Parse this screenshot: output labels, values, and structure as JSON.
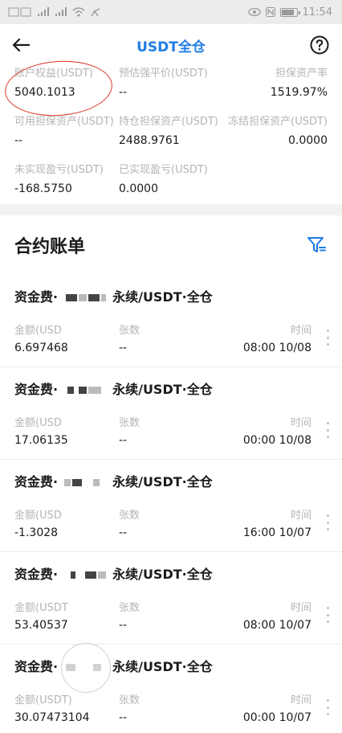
{
  "status_bar": {
    "time": "11:54"
  },
  "nav": {
    "title": "USDT全仓"
  },
  "summary": {
    "row1": [
      {
        "label": "账户权益(USDT)",
        "value": "5040.1013"
      },
      {
        "label": "预估强平价(USDT)",
        "value": "--"
      },
      {
        "label": "担保资产率",
        "value": "1519.97%"
      }
    ],
    "row2": [
      {
        "label": "可用担保资产(USDT)",
        "value": "--"
      },
      {
        "label": "持仓担保资产(USDT)",
        "value": "2488.9761"
      },
      {
        "label": "冻结担保资产(USDT)",
        "value": "0.0000"
      }
    ],
    "row3": [
      {
        "label": "未实现盈亏(USDT)",
        "value": "-168.5750"
      },
      {
        "label": "已实现盈亏(USDT)",
        "value": "0.0000"
      }
    ]
  },
  "bill": {
    "title": "合约账单",
    "entries": [
      {
        "title_prefix": "资金费·",
        "title_suffix": "永续/USDT·全仓",
        "amount_label": "金额(USD",
        "count_label": "张数",
        "time_label": "时间",
        "amount": "6.697468",
        "count": "--",
        "time": "08:00 10/08"
      },
      {
        "title_prefix": "资金费·",
        "title_suffix": "永续/USDT·全仓",
        "amount_label": "金额(USD",
        "count_label": "张数",
        "time_label": "时间",
        "amount": "17.06135",
        "count": "--",
        "time": "00:00 10/08"
      },
      {
        "title_prefix": "资金费·",
        "title_suffix": "永续/USDT·全仓",
        "amount_label": "金额(USD",
        "count_label": "张数",
        "time_label": "时间",
        "amount": "-1.3028",
        "count": "--",
        "time": "16:00 10/07"
      },
      {
        "title_prefix": "资金费·",
        "title_suffix": "永续/USDT·全仓",
        "amount_label": "金额(USDT",
        "count_label": "张数",
        "time_label": "时间",
        "amount": "53.40537",
        "count": "--",
        "time": "08:00 10/07"
      },
      {
        "title_prefix": "资金费·",
        "title_suffix": "永续/USDT·全仓",
        "amount_label": "金额(USDT)",
        "count_label": "张数",
        "time_label": "时间",
        "amount": "30.07473104",
        "count": "--",
        "time": "00:00 10/07"
      }
    ]
  },
  "colors": {
    "accent": "#1f7de6",
    "annotation": "#d9352a"
  },
  "icons": {
    "back": "arrow-left-icon",
    "help": "question-circle-icon",
    "filter": "filter-icon",
    "more": "more-vertical-icon"
  }
}
